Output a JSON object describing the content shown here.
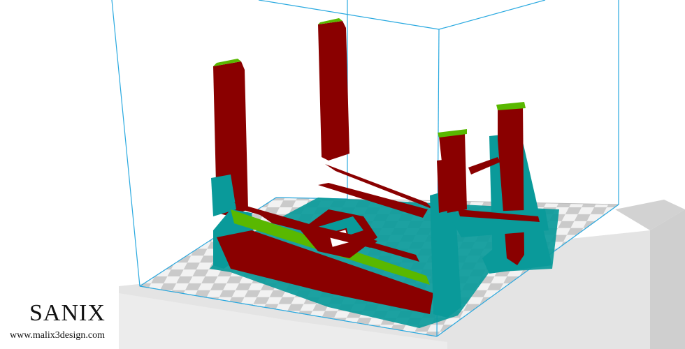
{
  "watermark": {
    "brand": "SANIX",
    "url": "www.malix3design.com"
  },
  "colors": {
    "model_red": "#8a0000",
    "support_teal": "#0a9a9a",
    "highlight_green": "#59b800",
    "volume_line": "#29a9e0",
    "checker_light": "#f2f2f2",
    "checker_dark": "#c9c9c9",
    "bed_frame": "#dadada"
  }
}
